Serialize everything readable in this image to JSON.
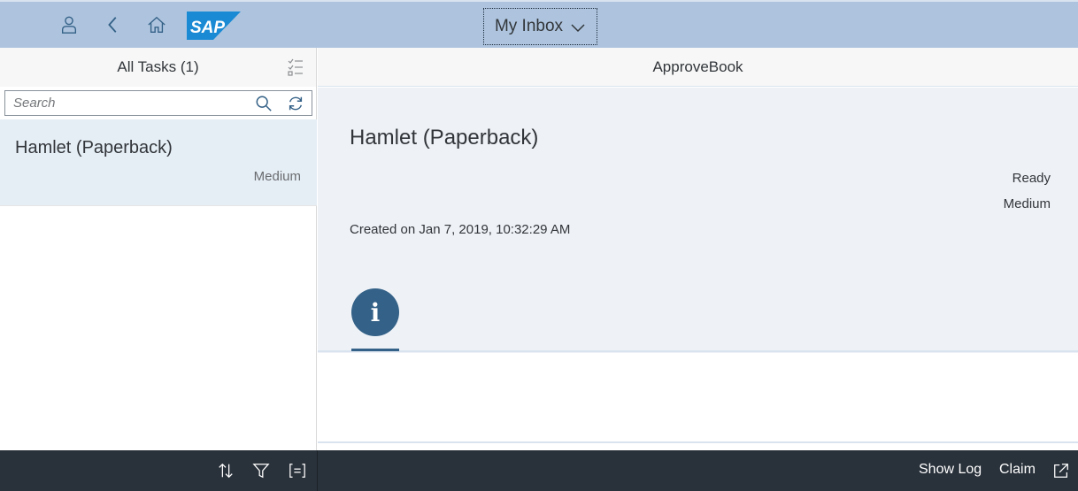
{
  "header": {
    "app_title": "My Inbox",
    "icons": [
      "user-icon",
      "back-icon",
      "home-icon"
    ],
    "logo_text": "SAP"
  },
  "master": {
    "title": "All Tasks (1)",
    "search": {
      "placeholder": "Search",
      "value": ""
    },
    "tasks": [
      {
        "title": "Hamlet (Paperback)",
        "priority": "Medium"
      }
    ],
    "footer_icons": [
      "sort-icon",
      "filter-icon",
      "group-icon"
    ]
  },
  "detail": {
    "page_title": "ApproveBook",
    "object": {
      "title": "Hamlet (Paperback)",
      "status": "Ready",
      "priority": "Medium",
      "created": "Created on Jan 7, 2019, 10:32:29 AM"
    },
    "tabs": [
      {
        "icon": "info-icon",
        "glyph": "i"
      }
    ],
    "footer": {
      "show_log": "Show Log",
      "claim": "Claim"
    }
  },
  "colors": {
    "shell": "#aec4de",
    "footer": "#29313a",
    "accent": "#346187",
    "selected_row": "#e5edf5"
  }
}
